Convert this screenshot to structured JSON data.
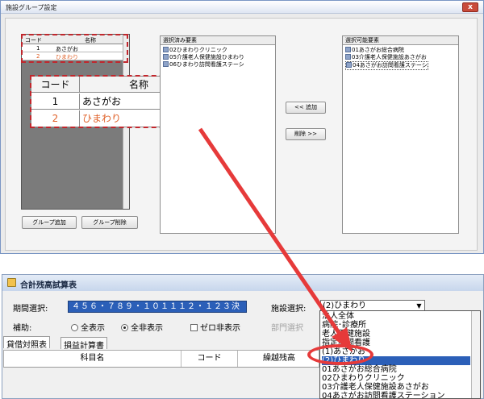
{
  "window1": {
    "title": "施設グループ設定",
    "close_glyph": "x"
  },
  "group_grid": {
    "col_code": "コード",
    "col_name": "名称",
    "rows": [
      {
        "code": "1",
        "name": "あさがお"
      },
      {
        "code": "2",
        "name": "ひまわり"
      }
    ],
    "highlight_color": "#e0622a"
  },
  "zoom_table": {
    "col_code": "コード",
    "col_name": "名称",
    "rows": [
      {
        "code": "1",
        "name": "あさがお"
      },
      {
        "code": "2",
        "name": "ひまわり"
      }
    ]
  },
  "buttons": {
    "add_group": "グループ追加",
    "delete_group": "グループ削除",
    "add": "<< 追加",
    "remove": "削除 >>"
  },
  "selected_panel": {
    "header": "選択済み要素",
    "items": [
      "02ひまわりクリニック",
      "05介護老人保健施設ひまわり",
      "06ひまわり訪問看護ステーシ"
    ]
  },
  "available_panel": {
    "header": "選択可能要素",
    "items": [
      "01あさがお総合病院",
      "03介護老人保健施設あさがお",
      "04あさがお訪問看護ステーシ"
    ]
  },
  "window2": {
    "title": "合計残高試算表"
  },
  "filters": {
    "period_label": "期間選択:",
    "period_value": "４５６・７８９・１０１１１２・１２３決",
    "facility_label": "施設選択:",
    "facility_value": "(2)ひまわり",
    "aux_label": "補助:",
    "radio_all_show": "全表示",
    "radio_all_hide": "全非表示",
    "zero_hide": "ゼロ非表示",
    "dept_select": "部門選択"
  },
  "tabs": [
    "貸借対照表",
    "損益計算書"
  ],
  "table": {
    "col_subject": "科目名",
    "col_code": "コード",
    "col_carry": "繰越残高"
  },
  "facility_options": [
    "法人全体",
    "病院･診療所",
    "老人保健施設",
    "指定訪問看護",
    "(1)あさがお",
    "(2)ひまわり",
    "01あさがお総合病院",
    "02ひまわりクリニック",
    "03介護老人保健施設あさがお",
    "04あさがお訪問看護ステーション"
  ],
  "facility_selected_index": 5,
  "colors": {
    "annotation_red": "#e63a3a",
    "selection_blue": "#2b5fb8"
  }
}
